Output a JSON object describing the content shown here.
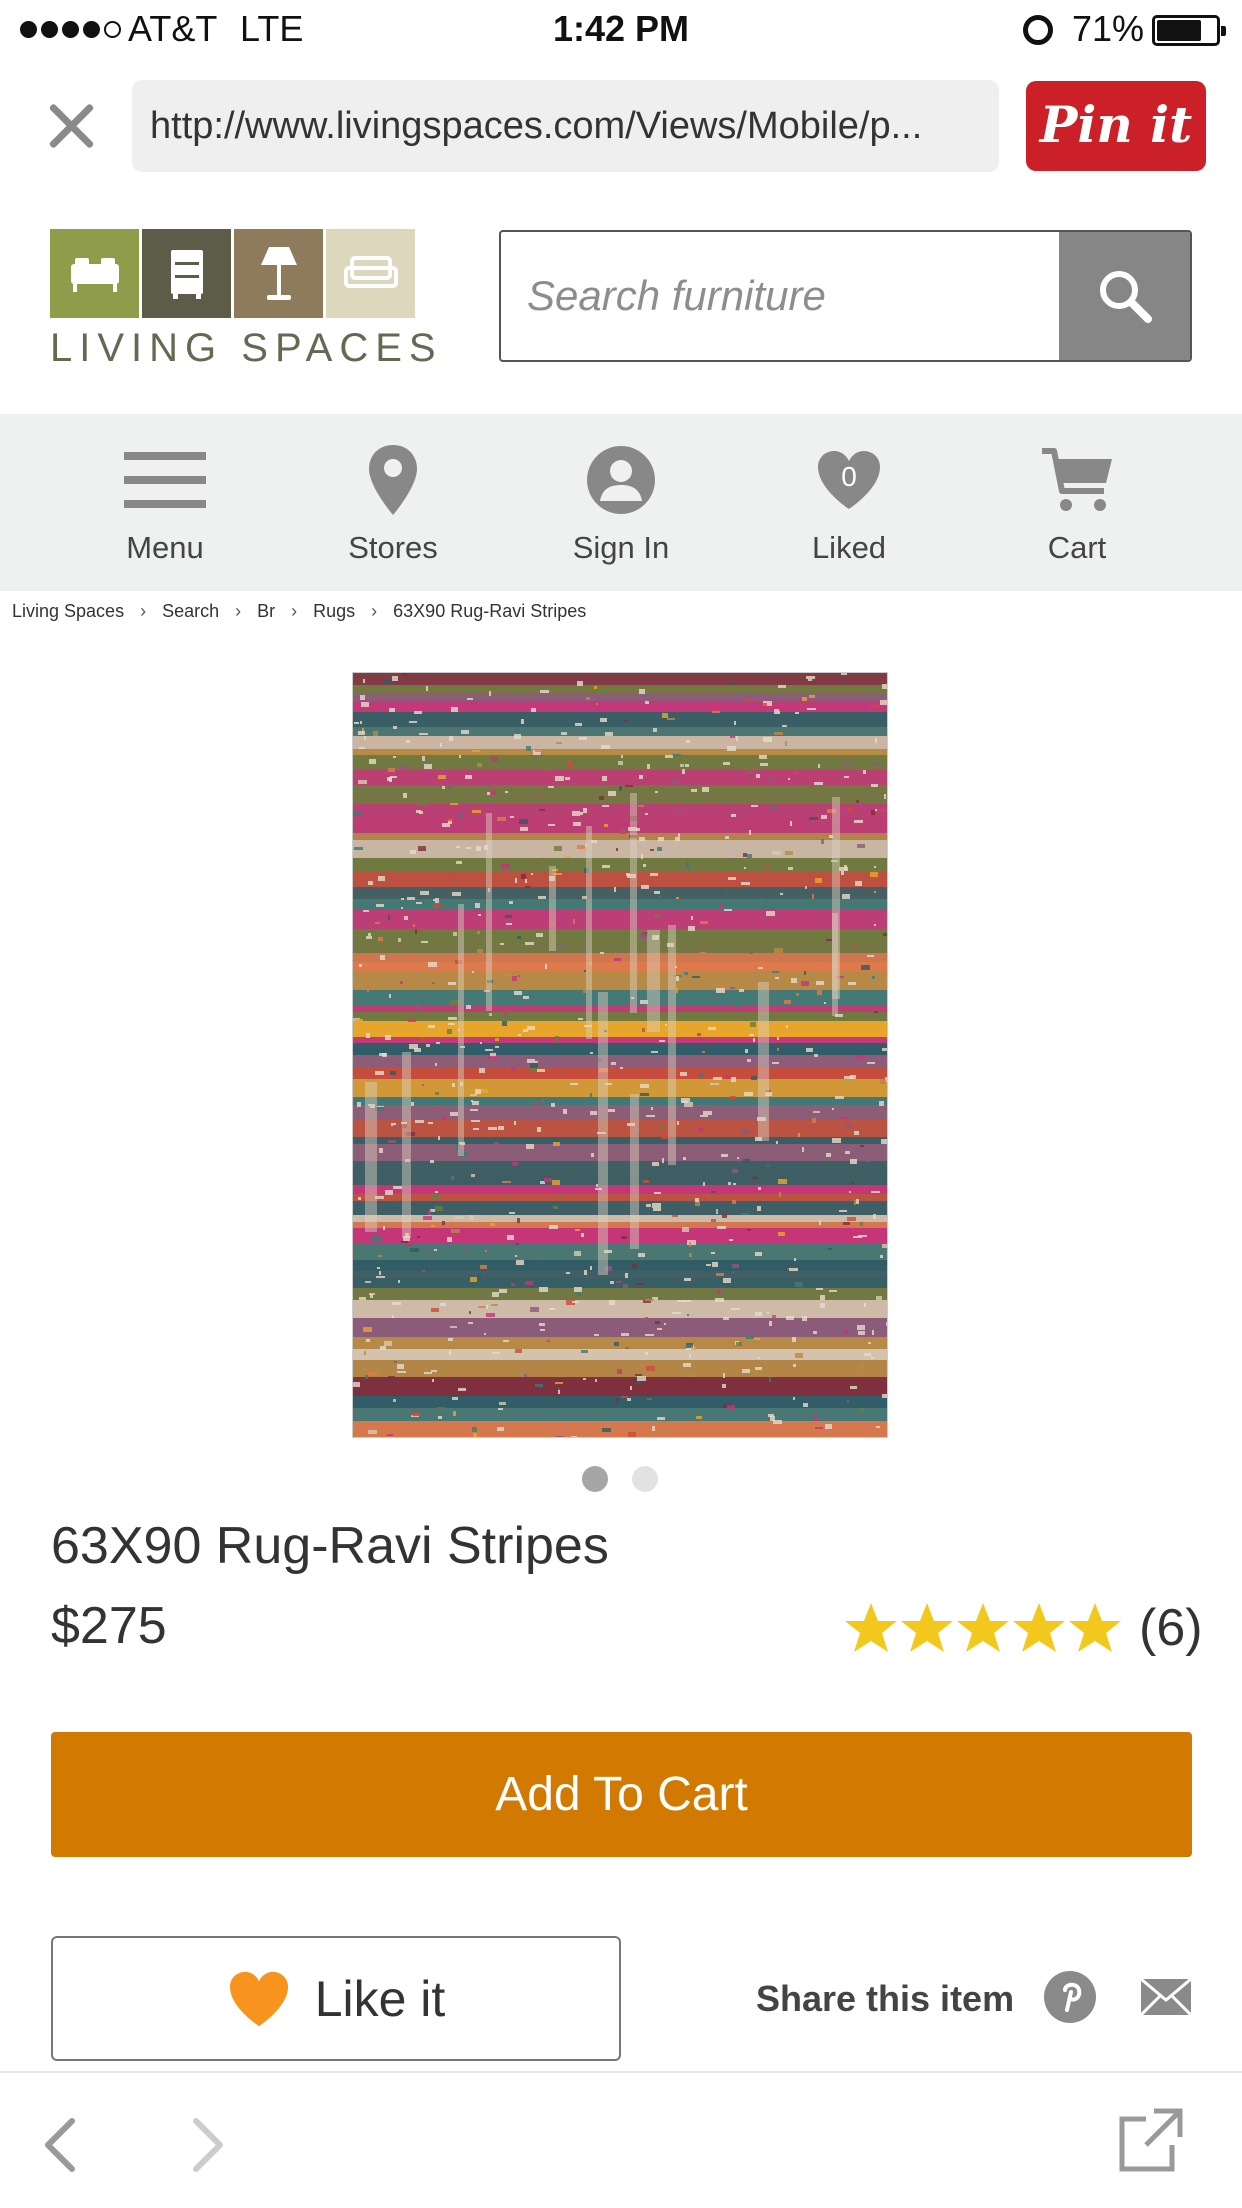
{
  "status_bar": {
    "carrier": "AT&T",
    "network": "LTE",
    "time": "1:42 PM",
    "battery": "71%",
    "battery_level": 0.71,
    "signal_bars_filled": 4,
    "signal_bars_total": 5
  },
  "browser": {
    "url": "http://www.livingspaces.com/Views/Mobile/p...",
    "pin_label": "Pin it",
    "pin_color": "#cb2027"
  },
  "header": {
    "logo_text": "LIVING SPACES",
    "logo_colors": [
      "#8f9d4b",
      "#5d5c49",
      "#8e7b5c",
      "#ddd8bd"
    ],
    "search_placeholder": "Search furniture"
  },
  "nav": {
    "items": [
      {
        "label": "Menu",
        "icon": "menu-icon"
      },
      {
        "label": "Stores",
        "icon": "map-pin-icon"
      },
      {
        "label": "Sign In",
        "icon": "user-icon"
      },
      {
        "label": "Liked",
        "icon": "heart-icon",
        "badge": "0"
      },
      {
        "label": "Cart",
        "icon": "cart-icon"
      }
    ]
  },
  "breadcrumb": [
    "Living Spaces",
    "Search",
    "Br",
    "Rugs",
    "63X90 Rug-Ravi Stripes"
  ],
  "product": {
    "image_count": 2,
    "active_image": 1,
    "title": "63X90 Rug-Ravi Stripes",
    "price": "$275",
    "rating_stars": 5,
    "review_count": "(6)",
    "add_to_cart_label": "Add To Cart",
    "cta_color": "#d17900"
  },
  "actions": {
    "like_label": "Like it",
    "share_label": "Share this item",
    "share_targets": [
      "pinterest-icon",
      "mail-icon"
    ]
  },
  "toolbar": {
    "icons": [
      "back-icon",
      "forward-icon",
      "open-in-browser-icon"
    ]
  }
}
